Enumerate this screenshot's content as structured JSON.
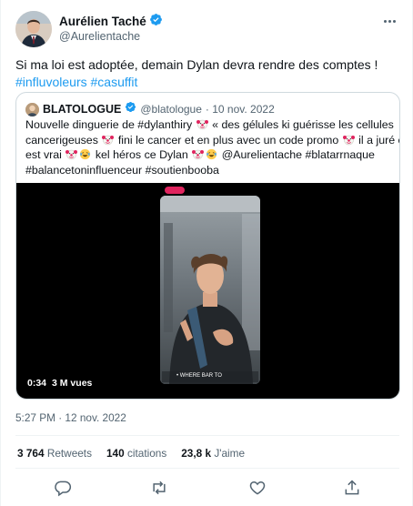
{
  "tweet": {
    "author_name": "Aurélien Taché",
    "author_handle": "@Aurelientache",
    "text_line1": "Si ma loi est adoptée, demain Dylan devra rendre des comptes !",
    "hashtag1": "#influvoleurs",
    "hashtag2": "#casuffit",
    "timestamp": "5:27 PM · 12 nov. 2022"
  },
  "quoted": {
    "author_name": "BLATOLOGUE",
    "author_handle": "@blatologue",
    "date": "· 10 nov. 2022",
    "line1_a": "Nouvelle dinguerie de #dylanthiry",
    "line1_b": "« des gélules ki guérisse les cellules",
    "line2_a": "cancerigeuses",
    "line2_b": "fini le cancer et en plus avec un code promo",
    "line2_c": "il a juré c",
    "line3_a": "est vrai",
    "line3_b": "kel héros ce Dylan",
    "line3_c": "@Aurelientache #blatarrnaque",
    "line4": "#balancetoninfluenceur #soutienbooba"
  },
  "video": {
    "duration": "0:34",
    "views": "3 M vues",
    "caption": "• WHERE BAR TO"
  },
  "stats": {
    "retweets_count": "3 764",
    "retweets_label": "Retweets",
    "quotes_count": "140",
    "quotes_label": "citations",
    "likes_count": "23,8 k",
    "likes_label": "J'aime"
  },
  "colors": {
    "accent": "#1d9bf0",
    "text": "#0f1419",
    "muted": "#536471",
    "border": "#cfd9de"
  },
  "icons": [
    "verified-badge-icon",
    "more-icon",
    "clown-emoji-icon",
    "laughing-emoji-icon",
    "reply-icon",
    "retweet-icon",
    "like-icon",
    "share-icon"
  ]
}
